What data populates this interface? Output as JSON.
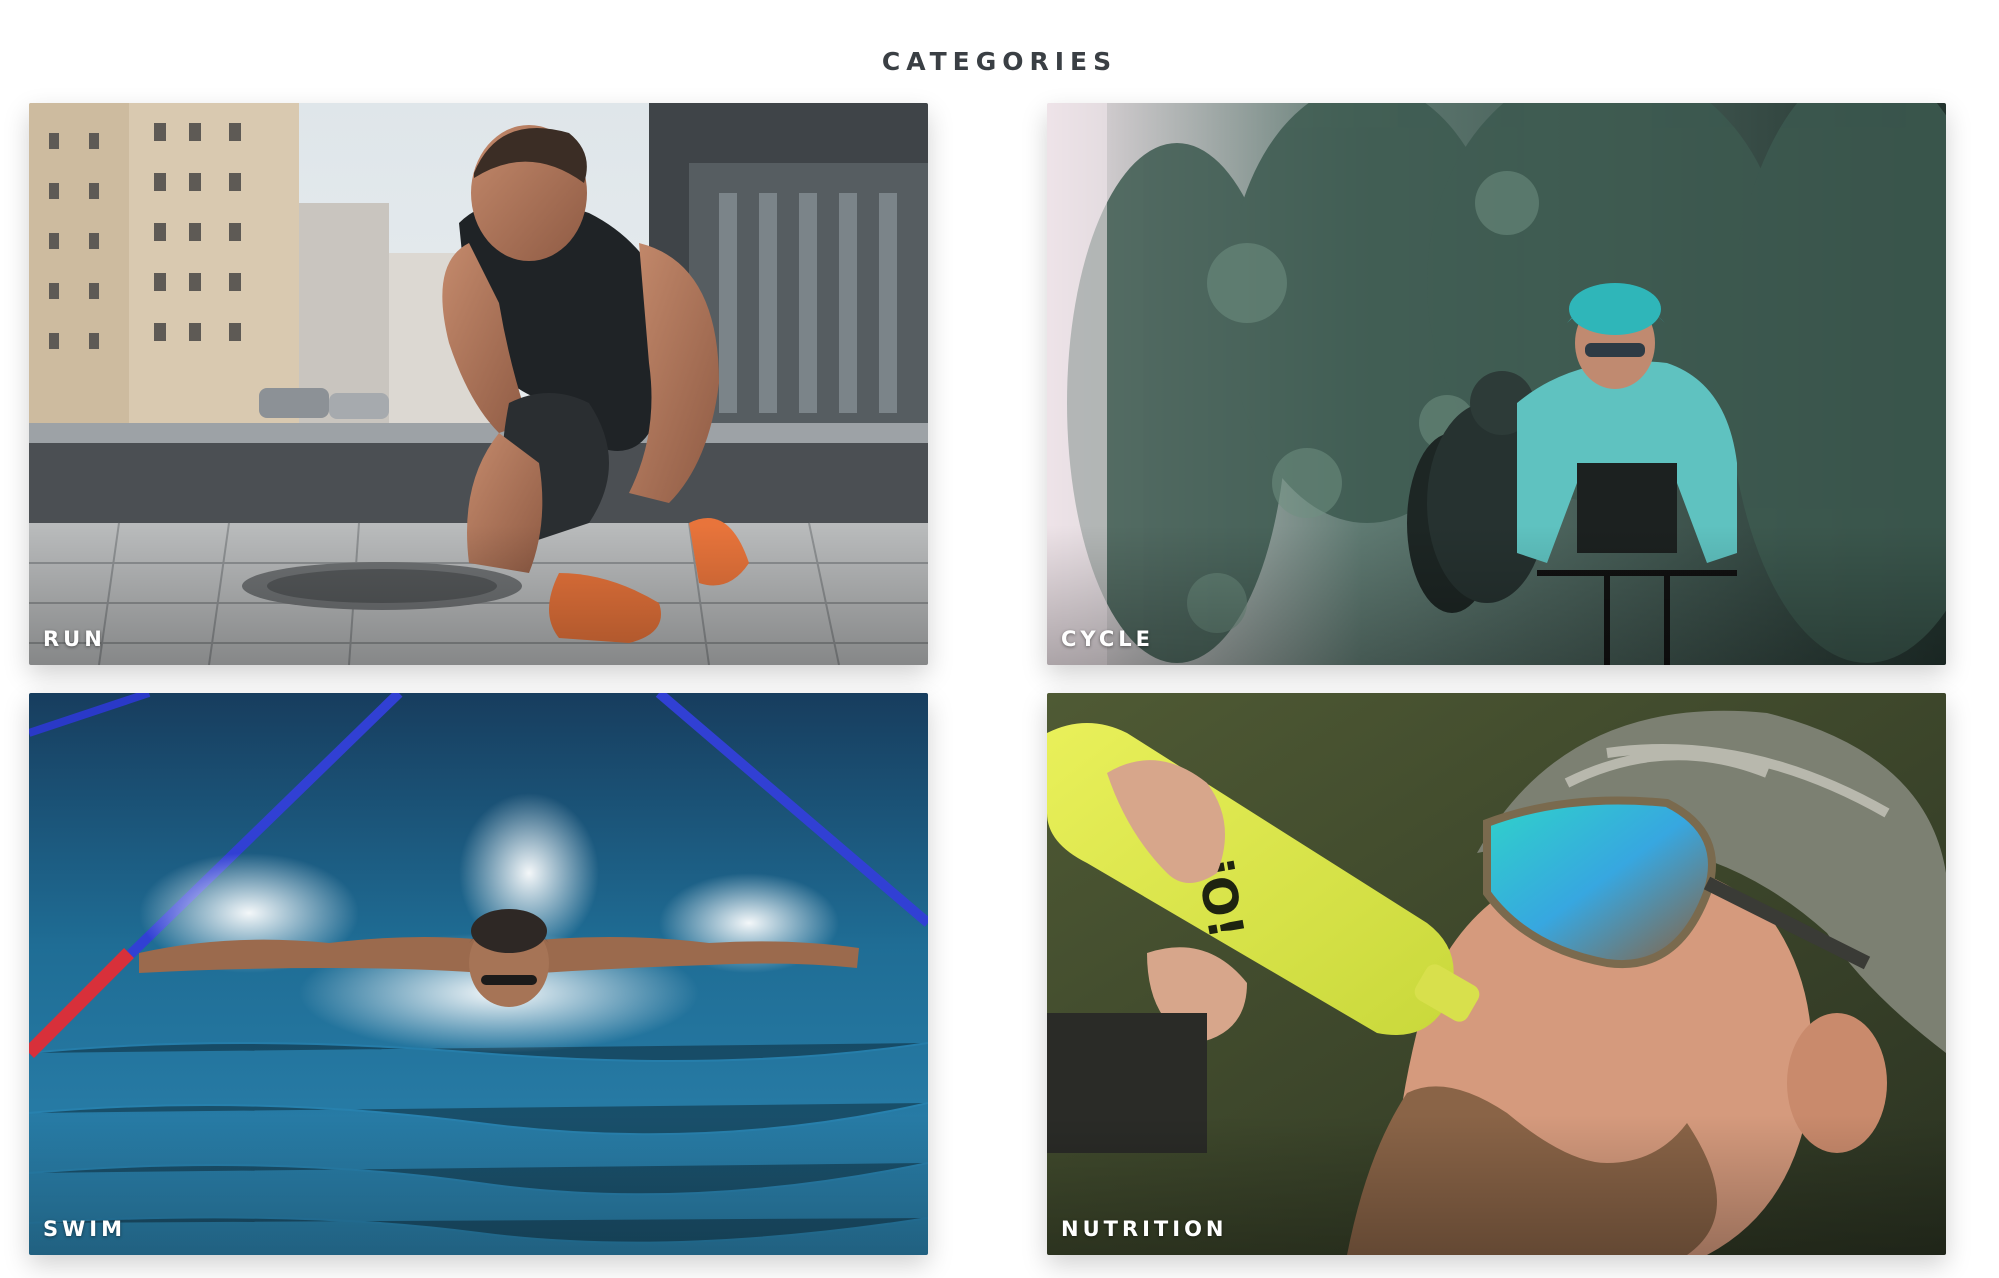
{
  "section": {
    "title": "CATEGORIES"
  },
  "categories": [
    {
      "label": "RUN",
      "photo": "runner-tying-shoe-photo"
    },
    {
      "label": "CYCLE",
      "photo": "cyclists-racing-photo"
    },
    {
      "label": "SWIM",
      "photo": "swimmer-butterfly-photo"
    },
    {
      "label": "NUTRITION",
      "photo": "cyclist-drinking-bottle-photo"
    }
  ],
  "colors": {
    "title": "#3a3f44",
    "label": "#ffffff",
    "background": "#ffffff"
  }
}
